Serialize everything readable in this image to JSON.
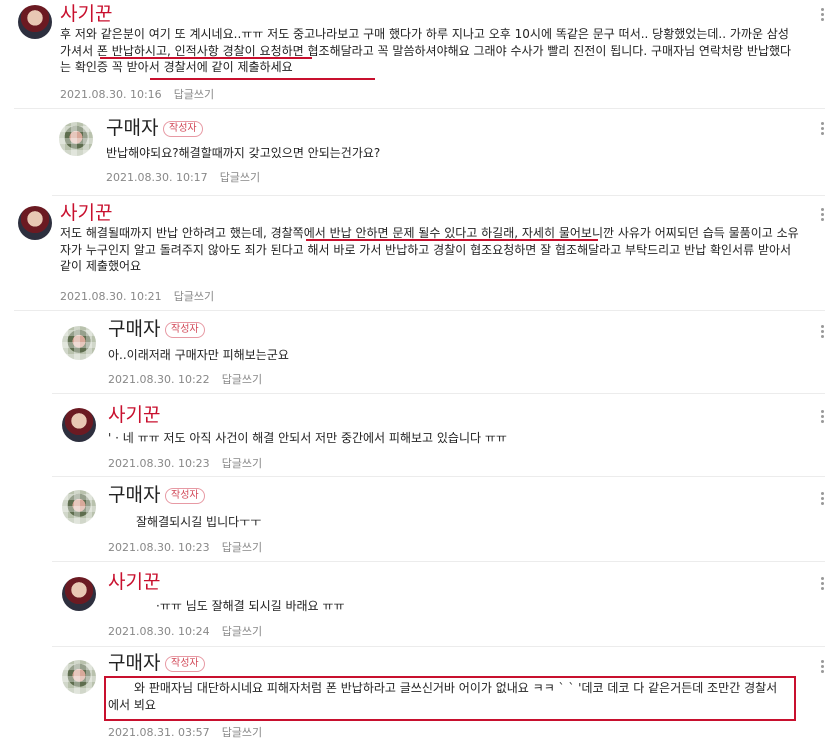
{
  "comments": [
    {
      "author": "사기꾼",
      "text": "후 저와 같은분이 여기 또 계시네요..ㅠㅠ 저도 중고나라보고 구매 했다가 하루 지나고 오후 10시에 똑같은 문구 떠서.. 당황했었는데.. 가까운 삼성 가셔서 폰 반납하시고, 인적사항 경찰이 요청하면 협조해달라고 꼭 말씀하셔야해요 그래야 수사가 빨리 진전이 됩니다. 구매자님 연락처랑 반납했다는 확인증 꼭 받아서 경찰서에 같이 제출하세요",
      "date": "2021.08.30. 10:16",
      "reply": "답글쓰기"
    },
    {
      "author": "구매자",
      "badge": "작성자",
      "text": "반납해야되요?해결할때까지 갖고있으면 안되는건가요?",
      "date": "2021.08.30. 10:17",
      "reply": "답글쓰기"
    },
    {
      "author": "사기꾼",
      "text": "저도 해결될때까지 반납 안하려고 했는데, 경찰쪽에서 반납 안하면 문제 될수 있다고 하길래, 자세히 물어보니깐 사유가 어찌되던 습득 물품이고 소유자가 누구인지 알고 돌려주지 않아도 죄가 된다고 해서 바로 가서 반납하고 경찰이 협조요청하면 잘 협조해달라고 부탁드리고 반납 확인서류 받아서 같이 제출했어요",
      "date": "2021.08.30. 10:21",
      "reply": "답글쓰기"
    },
    {
      "author": "구매자",
      "badge": "작성자",
      "text": "아..이래저래 구매자만 피해보는군요",
      "date": "2021.08.30. 10:22",
      "reply": "답글쓰기"
    },
    {
      "author": "사기꾼",
      "text": "' · 네 ㅠㅠ 저도 아직 사건이 해결 안되서 저만 중간에서 피해보고 있습니다 ㅠㅠ",
      "date": "2021.08.30. 10:23",
      "reply": "답글쓰기"
    },
    {
      "author": "구매자",
      "badge": "작성자",
      "text": "잘해결되시길 빕니다ㅜㅜ",
      "date": "2021.08.30. 10:23",
      "reply": "답글쓰기"
    },
    {
      "author": "사기꾼",
      "text": "·ㅠㅠ 님도 잘해결 되시길 바래요 ㅠㅠ",
      "date": "2021.08.30. 10:24",
      "reply": "답글쓰기"
    },
    {
      "author": "구매자",
      "badge": "작성자",
      "text": "와 판매자님 대단하시네요 피해자처럼 폰 반납하라고 글쓰신거바 어이가 없내요 ㅋㅋ ` ` '데코 데코 다 같은거든데 조만간 경찰서에서 뵈요",
      "date": "2021.08.31. 03:57",
      "reply": "답글쓰기"
    }
  ]
}
